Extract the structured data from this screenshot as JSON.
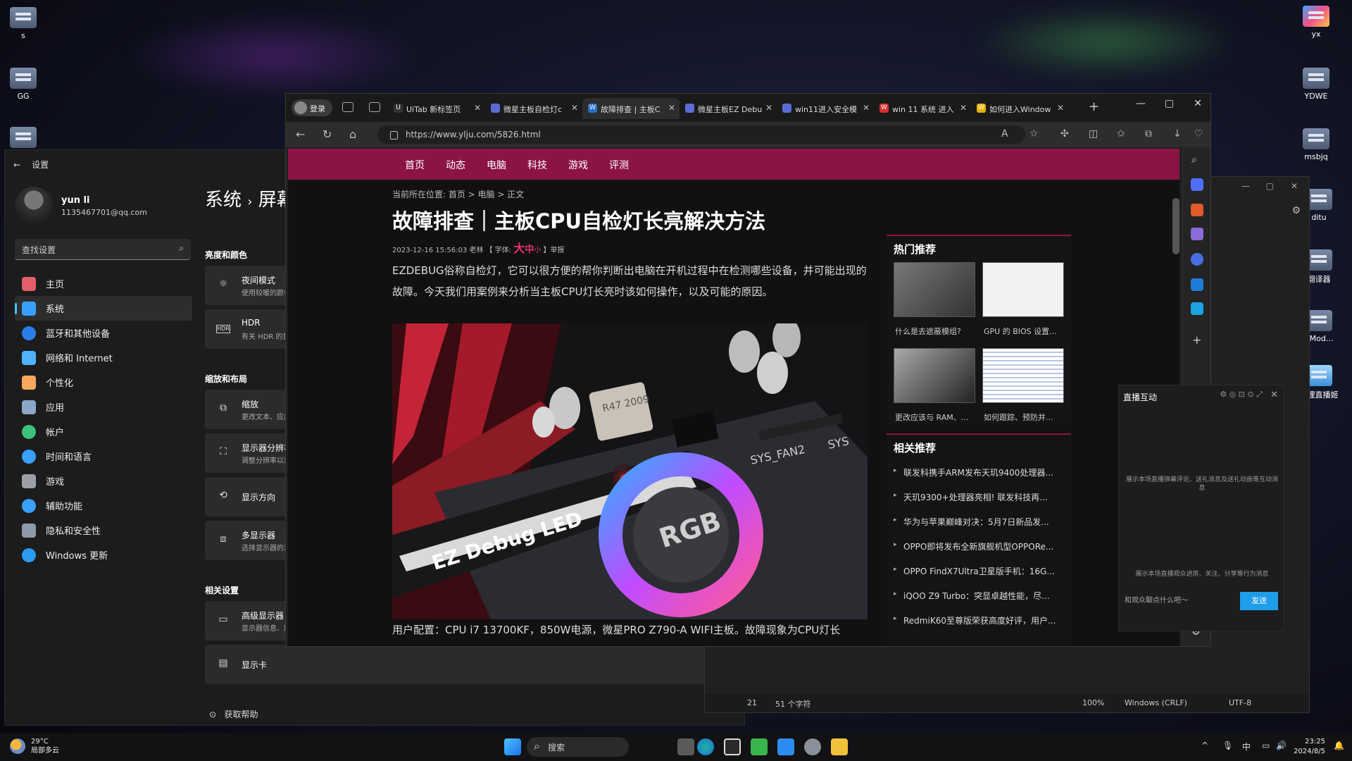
{
  "desktop": {
    "icons": [
      {
        "label": "s"
      },
      {
        "label": "GG"
      },
      {
        "label": ""
      },
      {
        "label": "yx"
      },
      {
        "label": "YDWE"
      },
      {
        "label": "msbjq"
      },
      {
        "label": "ditu"
      },
      {
        "label": "翻译器"
      },
      {
        "label": "3Mod..."
      },
      {
        "label": "哔哩直播姬"
      }
    ]
  },
  "settings": {
    "window_title": "设置",
    "back": "←",
    "user_name": "yun li",
    "user_email": "1135467701@qq.com",
    "search_placeholder": "查找设置",
    "nav": [
      {
        "label": "主页",
        "icon": "home-icon",
        "color": "#e35d6a"
      },
      {
        "label": "系统",
        "icon": "system-icon",
        "color": "#3aa0ff"
      },
      {
        "label": "蓝牙和其他设备",
        "icon": "bluetooth-icon",
        "color": "#2b7de9"
      },
      {
        "label": "网络和 Internet",
        "icon": "wifi-icon",
        "color": "#4fb3ff"
      },
      {
        "label": "个性化",
        "icon": "brush-icon",
        "color": "#f7a85e"
      },
      {
        "label": "应用",
        "icon": "apps-icon",
        "color": "#8aa6c8"
      },
      {
        "label": "帐户",
        "icon": "account-icon",
        "color": "#3ec07c"
      },
      {
        "label": "时间和语言",
        "icon": "globe-clock-icon",
        "color": "#3aa0ff"
      },
      {
        "label": "游戏",
        "icon": "gamepad-icon",
        "color": "#9aa0a6"
      },
      {
        "label": "辅助功能",
        "icon": "accessibility-icon",
        "color": "#3aa0ff"
      },
      {
        "label": "隐私和安全性",
        "icon": "shield-icon",
        "color": "#8c9aaa"
      },
      {
        "label": "Windows 更新",
        "icon": "update-icon",
        "color": "#2b9bf0"
      }
    ],
    "breadcrumb": {
      "part1": "系统",
      "sep": "›",
      "part2": "屏幕"
    },
    "sections": {
      "brightness": "亮度和颜色",
      "scale": "缩放和布局",
      "related": "相关设置"
    },
    "cards": [
      {
        "title": "夜间模式",
        "sub": "使用较暖的颜色"
      },
      {
        "title": "HDR",
        "sub": "有关 HDR 的更多信息"
      },
      {
        "title": "缩放",
        "sub": "更改文本、应用等项目的大小"
      },
      {
        "title": "显示器分辨率",
        "sub": "调整分辨率以适合所连接的显示器"
      },
      {
        "title": "显示方向",
        "sub": ""
      },
      {
        "title": "多显示器",
        "sub": "选择显示器的演示模式"
      },
      {
        "title": "高级显示器",
        "sub": "显示器信息、刷新率"
      },
      {
        "title": "显示卡",
        "sub": ""
      }
    ],
    "help": "获取帮助"
  },
  "notepad": {
    "status": {
      "line": "21",
      "chars": "51 个字符",
      "zoom": "100%",
      "eol": "Windows (CRLF)",
      "enc": "UTF-8"
    }
  },
  "browser": {
    "profile": "登录",
    "tabs": [
      {
        "label": "UiTab 新标签页",
        "fav": "U",
        "color": "#333"
      },
      {
        "label": "微星主板自检灯c",
        "fav": "微",
        "color": "#5b6bd6"
      },
      {
        "label": "故障排查 | 主板C",
        "fav": "W",
        "color": "#2a6fc9"
      },
      {
        "label": "微星主板EZ Debu",
        "fav": "微",
        "color": "#5b6bd6"
      },
      {
        "label": "win11进入安全模",
        "fav": "微",
        "color": "#5b6bd6"
      },
      {
        "label": "win 11 系统 进入",
        "fav": "W",
        "color": "#d9302b"
      },
      {
        "label": "如何进入Window",
        "fav": "W",
        "color": "#e4b100"
      }
    ],
    "url": "https://www.ylju.com/5826.html",
    "site": {
      "nav": [
        "首页",
        "动态",
        "电脑",
        "科技",
        "游戏",
        "评测"
      ],
      "breadcrumb": "当前所在位置: 首页 > 电脑 > 正文",
      "title": "故障排查｜主板CPU自检灯长亮解决方法",
      "meta_date": "2023-12-16 15:56:03 老林 【 字体:",
      "font_big": "大",
      "font_mid": "中",
      "font_small": "小",
      "meta_end": "】举报",
      "intro": "EZDEBUG俗称自检灯，它可以很方便的帮你判断出电脑在开机过程中在检测哪些设备，并可能出现的故障。今天我们用案例来分析当主板CPU灯长亮时该如何操作，以及可能的原因。",
      "photo_text": {
        "board_label": "EZ Debug LED",
        "rgb": "RGB",
        "chip": "R47 2009",
        "header": "SYS_FAN2",
        "series": "SYS"
      },
      "config": "用户配置：CPU i7 13700KF，850W电源，微星PRO Z790-A WIFI主板。故障现象为CPU灯长",
      "hot_title": "热门推荐",
      "hot": [
        "什么是去遮蔽模组?",
        "GPU 的 BIOS 设置...",
        "更改应该与 RAM、...",
        "如何跟踪、预防并..."
      ],
      "rel_title": "相关推荐",
      "related": [
        "联发科携手ARM发布天玑9400处理器...",
        "天玑9300+处理器亮相! 联发科技再...",
        "华为与苹果巅峰对决：5月7日新品发...",
        "OPPO即将发布全新旗舰机型OPPORe...",
        "OPPO FindX7Ultra卫星版手机：16G...",
        "iQOO Z9 Turbo：突显卓越性能，尽...",
        "RedmiK60至尊版荣获高度好评，用户..."
      ]
    }
  },
  "live": {
    "title": "直播互动",
    "msg1": "展示本场直播弹幕评论、送礼消息及送礼动画等互动消息",
    "msg2": "展示本场直播观众进房、关注、分享等行为消息",
    "input": "和观众聊点什么吧～",
    "send": "发送"
  },
  "taskbar": {
    "temp": "29°C",
    "weather": "局部多云",
    "search": "搜索",
    "ime": "中",
    "time": "23:25",
    "date": "2024/8/5"
  }
}
